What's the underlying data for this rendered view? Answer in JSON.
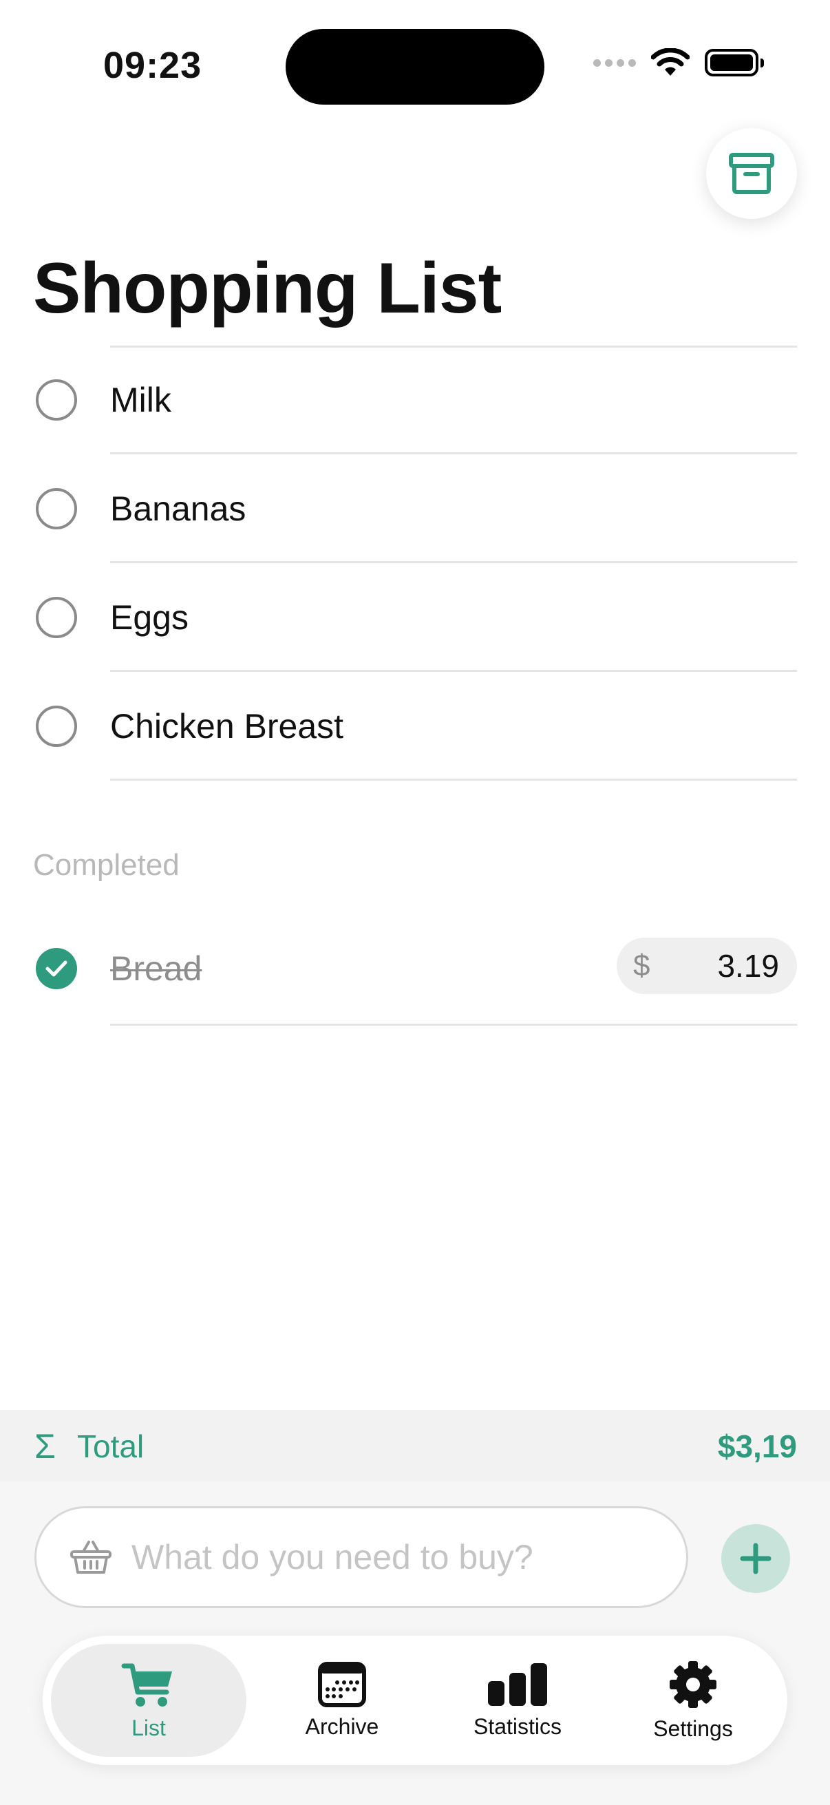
{
  "status_bar": {
    "time": "09:23"
  },
  "header": {
    "archive_icon": "archive-box-icon",
    "title": "Shopping List"
  },
  "items": [
    {
      "label": "Milk"
    },
    {
      "label": "Bananas"
    },
    {
      "label": "Eggs"
    },
    {
      "label": "Chicken Breast"
    }
  ],
  "completed": {
    "header": "Completed",
    "items": [
      {
        "label": "Bread",
        "currency": "$",
        "price": "3.19"
      }
    ]
  },
  "total": {
    "icon": "sigma-icon",
    "label": "Total",
    "value": "$3,19"
  },
  "add_item": {
    "placeholder": "What do you need to buy?",
    "input_icon": "basket-icon",
    "button_icon": "plus-icon"
  },
  "tabs": [
    {
      "label": "List",
      "icon": "cart-icon",
      "active": true
    },
    {
      "label": "Archive",
      "icon": "calendar-icon",
      "active": false
    },
    {
      "label": "Statistics",
      "icon": "bar-chart-icon",
      "active": false
    },
    {
      "label": "Settings",
      "icon": "gear-icon",
      "active": false
    }
  ],
  "colors": {
    "accent": "#2e9a7e",
    "accent_light": "#c7e3da",
    "muted_text": "#8d8d8d"
  }
}
